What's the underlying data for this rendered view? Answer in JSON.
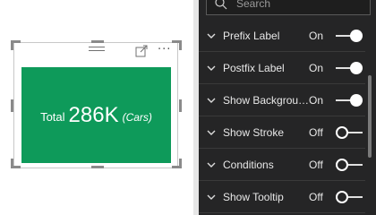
{
  "card": {
    "prefix": "Total",
    "value": "286K",
    "postfix": "(Cars)",
    "background_color": "#0e9a5a",
    "text_color": "#ffffff"
  },
  "canvas_icons": {
    "drag": "drag-handle-icon",
    "focus": "focus-mode-icon",
    "more": "more-options-icon"
  },
  "pane": {
    "search_placeholder": "Search",
    "background_color": "#252526",
    "rows": [
      {
        "label": "Prefix Label",
        "state": "On",
        "on": true
      },
      {
        "label": "Postfix Label",
        "state": "On",
        "on": true
      },
      {
        "label": "Show Backgrou…",
        "state": "On",
        "on": true
      },
      {
        "label": "Show Stroke",
        "state": "Off",
        "on": false
      },
      {
        "label": "Conditions",
        "state": "Off",
        "on": false
      },
      {
        "label": "Show Tooltip",
        "state": "Off",
        "on": false
      }
    ]
  }
}
